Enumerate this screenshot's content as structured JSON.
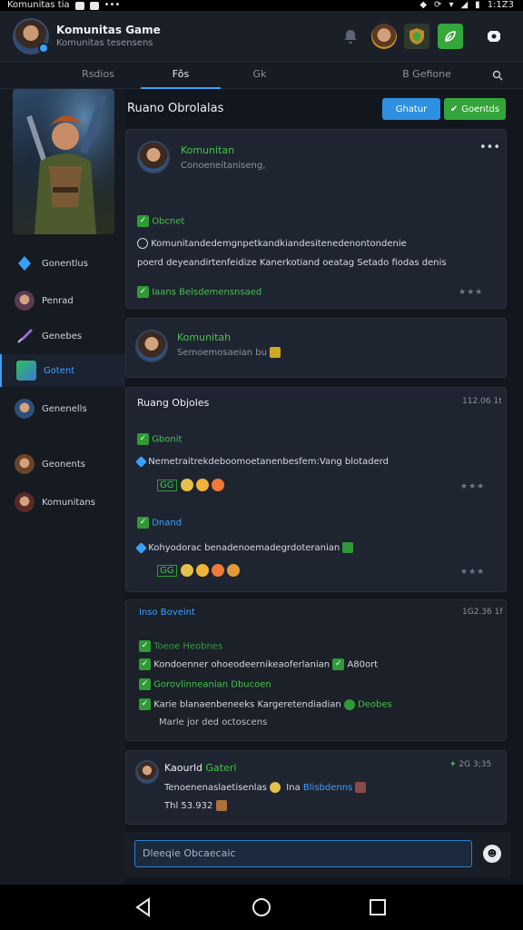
{
  "status": {
    "left_text": "Komunitas tia",
    "time": "1:1Z3"
  },
  "header": {
    "title": "Komunitas Game",
    "subtitle": "Komunitas tesensens"
  },
  "tabs": [
    "Rsdios",
    "Fôs",
    "Gk",
    "B Gefione"
  ],
  "sidebar": {
    "items": [
      {
        "label": "Gonentlus",
        "icon": "diamond-icon",
        "active": false
      },
      {
        "label": "Penrad",
        "icon": "avatar-icon",
        "active": false
      },
      {
        "label": "Genebes",
        "icon": "sword-icon",
        "active": false
      },
      {
        "label": "Gotent",
        "icon": "gem-icon",
        "active": true
      },
      {
        "label": "Genenells",
        "icon": "avatar-icon",
        "active": false
      },
      {
        "label": "Geonents",
        "icon": "avatar-icon",
        "active": false
      },
      {
        "label": "Komunitans",
        "icon": "avatar-icon",
        "active": false
      }
    ]
  },
  "room": {
    "title": "Ruano Obrolalas",
    "btn_blue": "Ghatur",
    "btn_green": "Goentds"
  },
  "card1": {
    "author": "Komunitan",
    "subtitle": "Conoeneitaniseng,",
    "tag": "Obcnet",
    "line1": "Komunitandedemgnpetkandkiandesitenedenontondenie",
    "line2": "poerd deyeandirtenfeidize Kanerkotiand oeatag Setado fiodas denis",
    "footer": "Iaans Belsdemensnsaed"
  },
  "card2": {
    "author": "Komunitah",
    "line": "Semoemosaeian bu"
  },
  "card3": {
    "title": "Ruang Objoles",
    "time": "112.06 1t",
    "blocks": [
      {
        "tag": "Gbonit",
        "text": "Nemetraitrekdeboomoetanenbesfem:Vang blotaderd",
        "badge": "GG"
      },
      {
        "tag": "Dnand",
        "text": "Kohyodorac benadenoemadegrdoteranian",
        "badge": "GG"
      }
    ]
  },
  "card4": {
    "title": "Inso Boveint",
    "time": "1G2.36 1f",
    "lines": [
      {
        "text": "Toeoe Heobnes",
        "style": "green-muted"
      },
      {
        "text": "Kondoenner ohoeodeernikeaoferlanian",
        "extra": "A80ort"
      },
      {
        "text": "Gorovlinneanian Dbucoen",
        "style": "green"
      },
      {
        "text": "Karie blanaenbeneeks Kargeretendiadian",
        "extra": "Deobes"
      },
      {
        "text": "Marle jor ded octoscens",
        "style": "muted"
      }
    ]
  },
  "card5": {
    "author": "Kaourld",
    "author_tag": "Gateri",
    "time": "2G 3;35",
    "line1": "Tenoenenaslaetisenlas",
    "line1_b": "Ina",
    "line1_link": "Blisbdenns",
    "line2": "Thl 53.932"
  },
  "composer": {
    "placeholder": "Dleeqie Obcaecaic"
  },
  "colors": {
    "accent": "#3aa0ff",
    "green": "#46c24c",
    "bg": "#12161d"
  }
}
